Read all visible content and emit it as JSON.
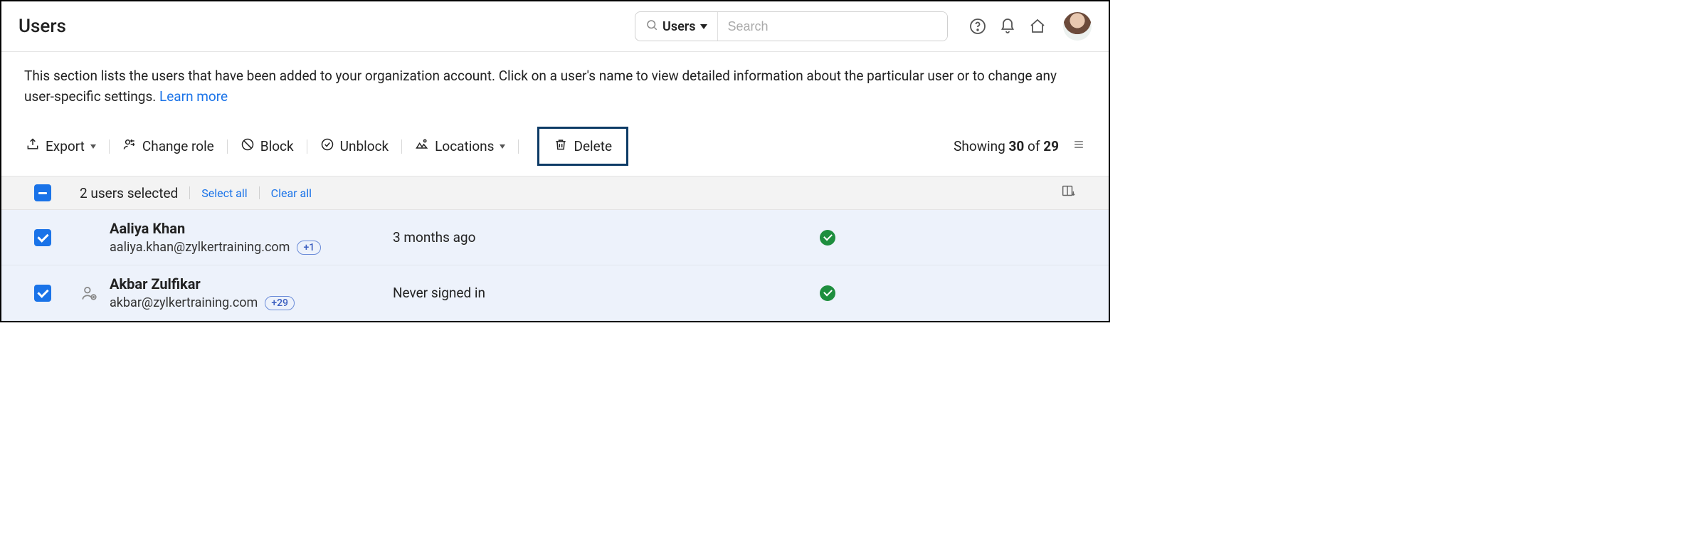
{
  "header": {
    "title": "Users",
    "search": {
      "scope": "Users",
      "placeholder": "Search"
    }
  },
  "intro": {
    "text": "This section lists the users that have been added to your organization account. Click on a user's name to view detailed information about the particular user or to change any user-specific settings.  ",
    "learn_more": "Learn more"
  },
  "toolbar": {
    "export": "Export",
    "change_role": "Change role",
    "block": "Block",
    "unblock": "Unblock",
    "locations": "Locations",
    "delete": "Delete",
    "showing_prefix": "Showing ",
    "showing_count": "30",
    "showing_of": " of ",
    "showing_total": "29"
  },
  "selection": {
    "text": "2 users selected",
    "select_all": "Select all",
    "clear_all": "Clear all"
  },
  "rows": [
    {
      "name": "Aaliya Khan",
      "email": "aaliya.khan@zylkertraining.com",
      "badge": "+1",
      "last": "3 months ago"
    },
    {
      "name": "Akbar Zulfikar",
      "email": "akbar@zylkertraining.com",
      "badge": "+29",
      "last": "Never signed in"
    }
  ]
}
